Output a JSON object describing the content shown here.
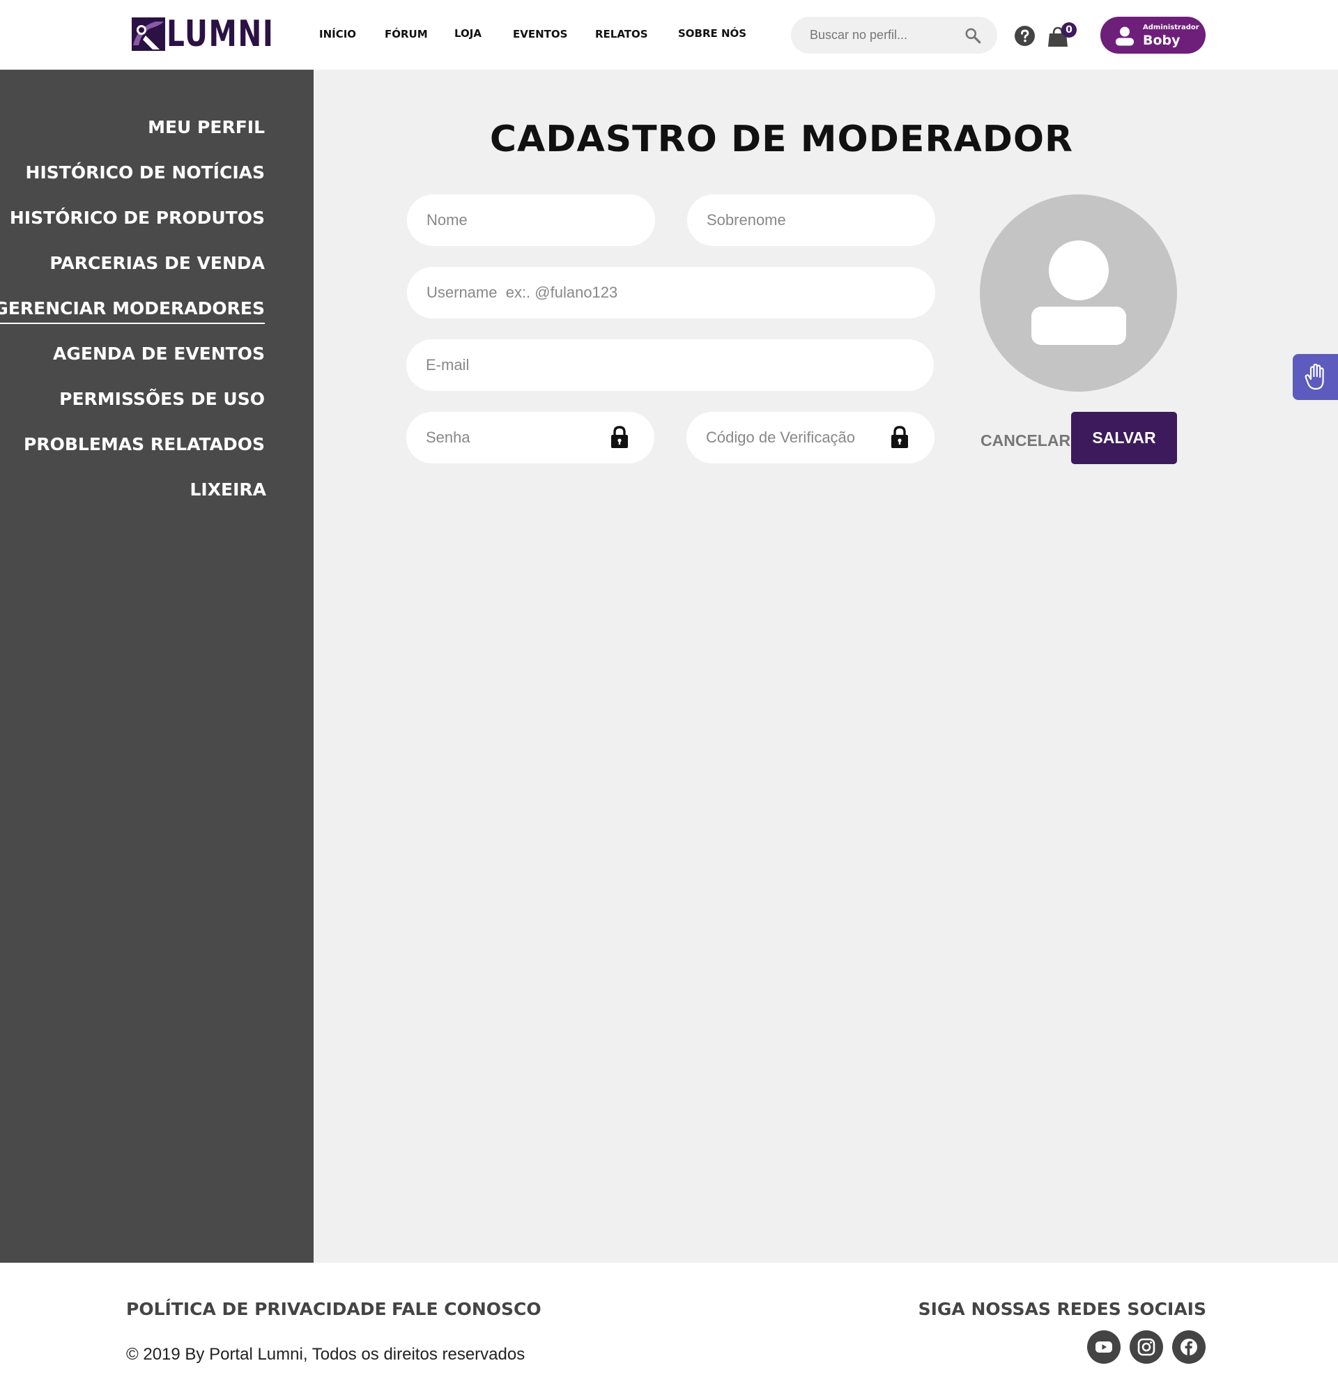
{
  "header": {
    "logo_text": "LUMNI",
    "nav": [
      "INÍCIO",
      "FÓRUM",
      "LOJA",
      "EVENTOS",
      "RELATOS",
      "SOBRE NÓS"
    ],
    "search_placeholder": "Buscar no perfil...",
    "cart_count": "0",
    "user_role": "Administrador",
    "user_name": "Boby"
  },
  "sidebar": {
    "items": [
      {
        "label": "MEU PERFIL"
      },
      {
        "label": "HISTÓRICO DE NOTÍCIAS"
      },
      {
        "label": "HISTÓRICO DE PRODUTOS"
      },
      {
        "label": "PARCERIAS DE VENDA"
      },
      {
        "label": "GERENCIAR MODERADORES"
      },
      {
        "label": "AGENDA DE EVENTOS"
      },
      {
        "label": "PERMISSÕES DE USO"
      },
      {
        "label": "PROBLEMAS RELATADOS"
      },
      {
        "label": "LIXEIRA"
      }
    ],
    "active": "GERENCIAR MODERADORES"
  },
  "form": {
    "title": "CADASTRO DE MODERADOR",
    "first_name_placeholder": "Nome",
    "last_name_placeholder": "Sobrenome",
    "username_placeholder": "Username  ex:. @fulano123",
    "email_placeholder": "E-mail",
    "password_placeholder": "Senha",
    "code_placeholder": "Código de Verificação",
    "cancel_label": "CANCELAR",
    "save_label": "SALVAR"
  },
  "footer": {
    "privacy": "POLÍTICA DE PRIVACIDADE",
    "contact": "FALE CONOSCO",
    "social_title": "SIGA NOSSAS REDES SOCIAIS",
    "copyright": "© 2019 By Portal Lumni, Todos os direitos reservados",
    "social_icons": [
      "youtube-icon",
      "instagram-icon",
      "facebook-icon"
    ]
  },
  "colors": {
    "brand_purple": "#3c1a5c",
    "user_pill": "#6e1f7a",
    "sidebar_bg": "#4a4a4a",
    "main_bg": "#f0f0f0",
    "a11y_button": "#5d5bbd"
  }
}
